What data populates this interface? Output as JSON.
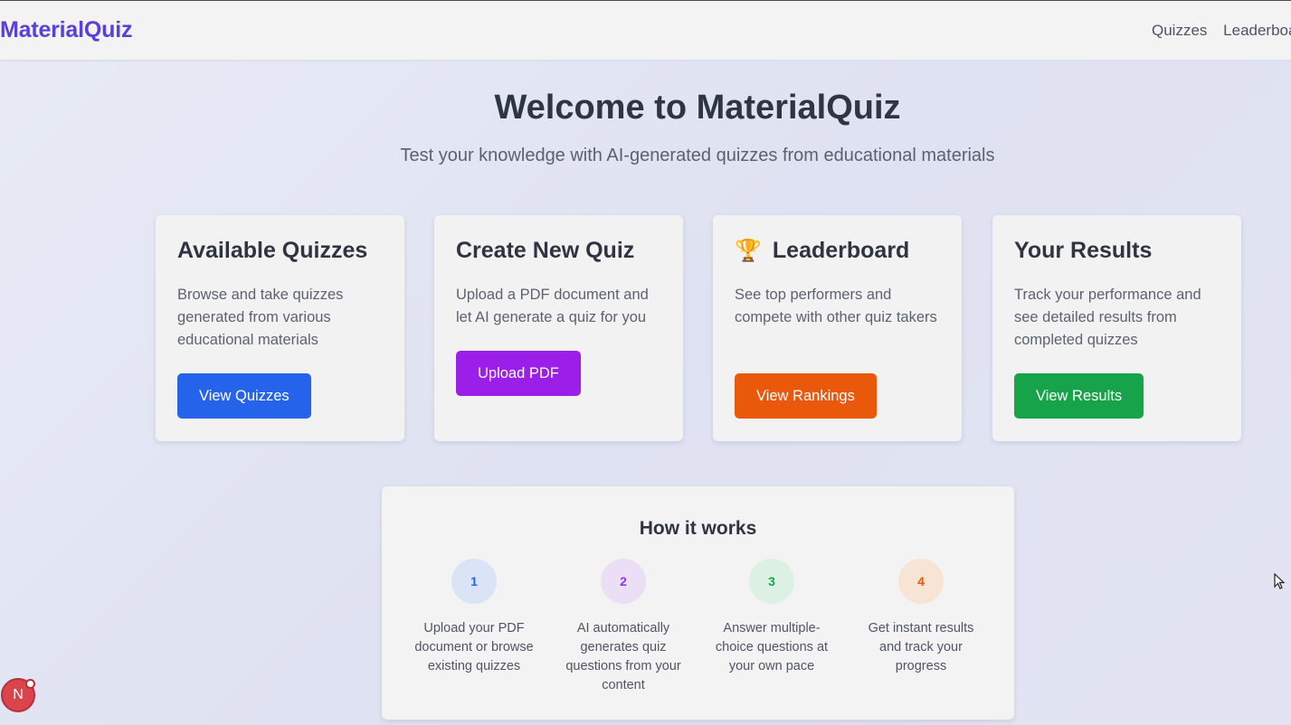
{
  "header": {
    "brand": "MaterialQuiz",
    "nav": [
      {
        "label": "Quizzes"
      },
      {
        "label": "Leaderboa"
      }
    ]
  },
  "hero": {
    "title": "Welcome to MaterialQuiz",
    "subtitle": "Test your knowledge with AI-generated quizzes from educational materials"
  },
  "cards": [
    {
      "title": "Available Quizzes",
      "description": "Browse and take quizzes generated from various educational materials",
      "button": "View Quizzes",
      "button_color": "#2563eb"
    },
    {
      "title": "Create New Quiz",
      "description": "Upload a PDF document and let AI generate a quiz for you",
      "button": "Upload PDF",
      "button_color": "#9b1fe8"
    },
    {
      "title": "Leaderboard",
      "icon": "🏆",
      "description": "See top performers and compete with other quiz takers",
      "button": "View Rankings",
      "button_color": "#ea580c"
    },
    {
      "title": "Your Results",
      "description": "Track your performance and see detailed results from completed quizzes",
      "button": "View Results",
      "button_color": "#16a34a"
    }
  ],
  "how_it_works": {
    "title": "How it works",
    "steps": [
      {
        "number": "1",
        "text": "Upload your PDF document or browse existing quizzes",
        "color": "#2563eb",
        "bg": "#dbe3f6"
      },
      {
        "number": "2",
        "text": "AI automatically generates quiz questions from your content",
        "color": "#9333ea",
        "bg": "#ebdff5"
      },
      {
        "number": "3",
        "text": "Answer multiple-choice questions at your own pace",
        "color": "#16a34a",
        "bg": "#dcf0e3"
      },
      {
        "number": "4",
        "text": "Get instant results and track your progress",
        "color": "#ea580c",
        "bg": "#f7e4d4"
      }
    ]
  },
  "notification_badge": {
    "letter": "N"
  }
}
